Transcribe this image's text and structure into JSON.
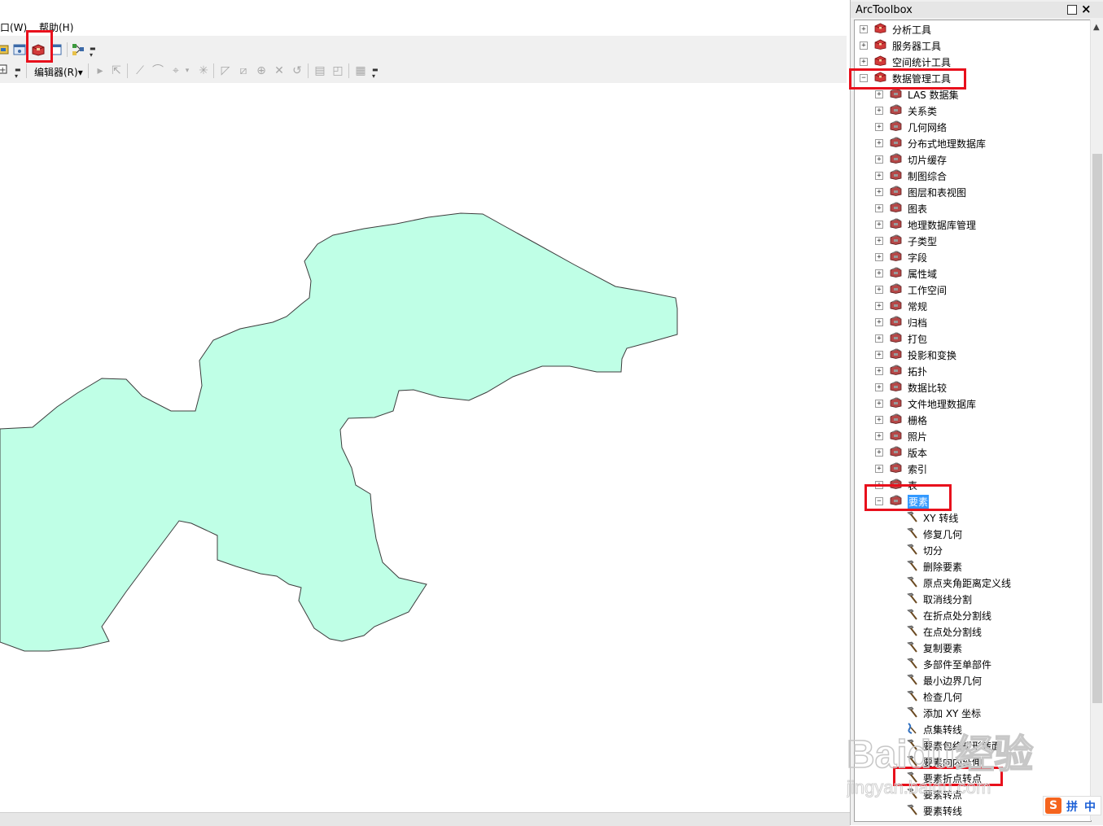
{
  "menubar": {
    "window_menu": "口(W)",
    "help_menu": "帮助(H)"
  },
  "editor_toolbar": {
    "editor_label": "编辑器(R)",
    "editor_dropdown_arrow": "▾"
  },
  "toolbox": {
    "title": "ArcToolbox",
    "close_glyph": "×",
    "top_level": [
      {
        "label": "分析工具",
        "expander": "+"
      },
      {
        "label": "服务器工具",
        "expander": "+"
      },
      {
        "label": "空间统计工具",
        "expander": "+"
      },
      {
        "label": "数据管理工具",
        "expander": "−"
      }
    ],
    "data_management_children": [
      "LAS 数据集",
      "关系类",
      "几何网络",
      "分布式地理数据库",
      "切片缓存",
      "制图综合",
      "图层和表视图",
      "图表",
      "地理数据库管理",
      "子类型",
      "字段",
      "属性域",
      "工作空间",
      "常规",
      "归档",
      "打包",
      "投影和变换",
      "拓扑",
      "数据比较",
      "文件地理数据库",
      "栅格",
      "照片",
      "版本",
      "索引",
      "表"
    ],
    "expanded_toolset": {
      "label": "要素",
      "expander": "−"
    },
    "feature_tools": [
      "XY 转线",
      "修复几何",
      "切分",
      "删除要素",
      "原点夹角距离定义线",
      "取消线分割",
      "在折点处分割线",
      "在点处分割线",
      "复制要素",
      "多部件至单部件",
      "最小边界几何",
      "检查几何",
      "添加 XY 坐标",
      "点集转线",
      "要素包络矩形转面",
      "要素向内延伸",
      "要素折点转点",
      "要素转点",
      "要素转线"
    ],
    "collapsed_expander": "+"
  },
  "watermark": {
    "brand": "Baidu经验",
    "url": "jingyan.baidu.com"
  },
  "ime": {
    "logo": "S",
    "mode": "拼",
    "lang": "中"
  },
  "colors": {
    "polygon_fill": "#bfffe6",
    "polygon_stroke": "#3c3c3c",
    "highlight_red": "#e8101c",
    "selection_blue": "#3399ff"
  }
}
